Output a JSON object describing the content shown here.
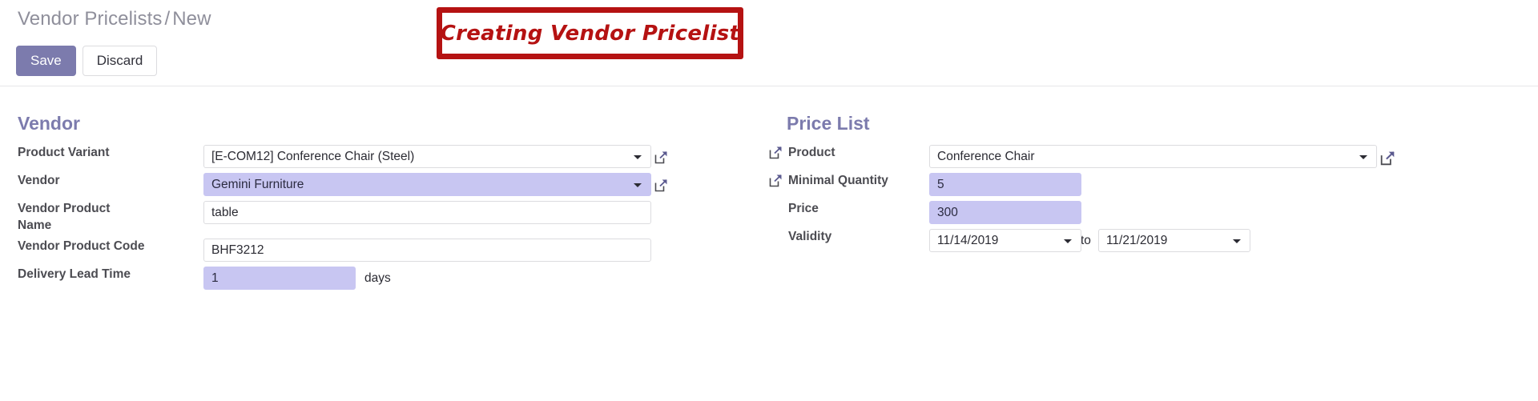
{
  "header": {
    "breadcrumb_root": "Vendor Pricelists",
    "breadcrumb_sep": "/",
    "breadcrumb_current": "New",
    "save_label": "Save",
    "discard_label": "Discard"
  },
  "annotation": {
    "text": "Creating Vendor Pricelist",
    "border_color": "#b51212",
    "text_color": "#b51212"
  },
  "vendor_group": {
    "title": "Vendor",
    "fields": {
      "product_variant": {
        "label": "Product Variant",
        "value": "[E-COM12] Conference Chair (Steel)"
      },
      "vendor": {
        "label": "Vendor",
        "value": "Gemini Furniture"
      },
      "vendor_product_name": {
        "label": "Vendor Product Name",
        "value": "table"
      },
      "vendor_product_code": {
        "label": "Vendor Product Code",
        "value": "BHF3212"
      },
      "delivery_lead_time": {
        "label": "Delivery Lead Time",
        "value": "1",
        "suffix": "days"
      }
    }
  },
  "price_list_group": {
    "title": "Price List",
    "fields": {
      "product": {
        "label": "Product",
        "value": "Conference Chair",
        "icon": "external-link-icon"
      },
      "minimal_quantity": {
        "label": "Minimal Quantity",
        "value": "5",
        "icon": "external-link-icon"
      },
      "price": {
        "label": "Price",
        "value": "300"
      },
      "validity": {
        "label": "Validity",
        "start": "11/14/2019",
        "separator": "to",
        "end": "11/21/2019"
      }
    }
  },
  "colors": {
    "accent_purple": "#7c7bad",
    "field_highlight": "#c8c6f2",
    "label_text": "#4c4c52",
    "breadcrumb_text": "#8f8f9b"
  }
}
